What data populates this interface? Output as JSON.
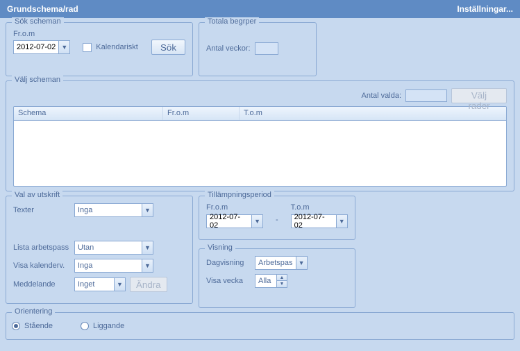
{
  "header": {
    "title": "Grundschema/rad",
    "settings": "Inställningar..."
  },
  "sok": {
    "legend": "Sök scheman",
    "from_label": "Fr.o.m",
    "from_value": "2012-07-02",
    "kalendariskt_label": "Kalendariskt",
    "sok_button": "Sök"
  },
  "totala": {
    "legend": "Totala  begrper",
    "antal_veckor_label": "Antal veckor:",
    "antal_veckor_value": ""
  },
  "valj": {
    "legend": "Välj scheman",
    "antal_valda_label": "Antal valda:",
    "antal_valda_value": "",
    "valj_rader_button": "Välj rader",
    "columns": {
      "schema": "Schema",
      "from": "Fr.o.m",
      "tom": "T.o.m"
    }
  },
  "utskrift": {
    "legend": "Val av utskrift",
    "texter_label": "Texter",
    "texter_value": "Inga",
    "lista_label": "Lista arbetspass",
    "lista_value": "Utan",
    "kalender_label": "Visa kalenderv.",
    "kalender_value": "Inga",
    "meddelande_label": "Meddelande",
    "meddelande_value": "Inget",
    "andra_button": "Ändra"
  },
  "tillamp": {
    "legend": "Tillämpningsperiod",
    "from_label": "Fr.o.m",
    "from_value": "2012-07-02",
    "sep": "-",
    "tom_label": "T.o.m",
    "tom_value": "2012-07-02"
  },
  "visning": {
    "legend": "Visning",
    "dag_label": "Dagvisning",
    "dag_value": "Arbetspas",
    "vecka_label": "Visa vecka",
    "vecka_value": "Alla"
  },
  "orientering": {
    "legend": "Orientering",
    "staende": "Stående",
    "liggande": "Liggande"
  }
}
